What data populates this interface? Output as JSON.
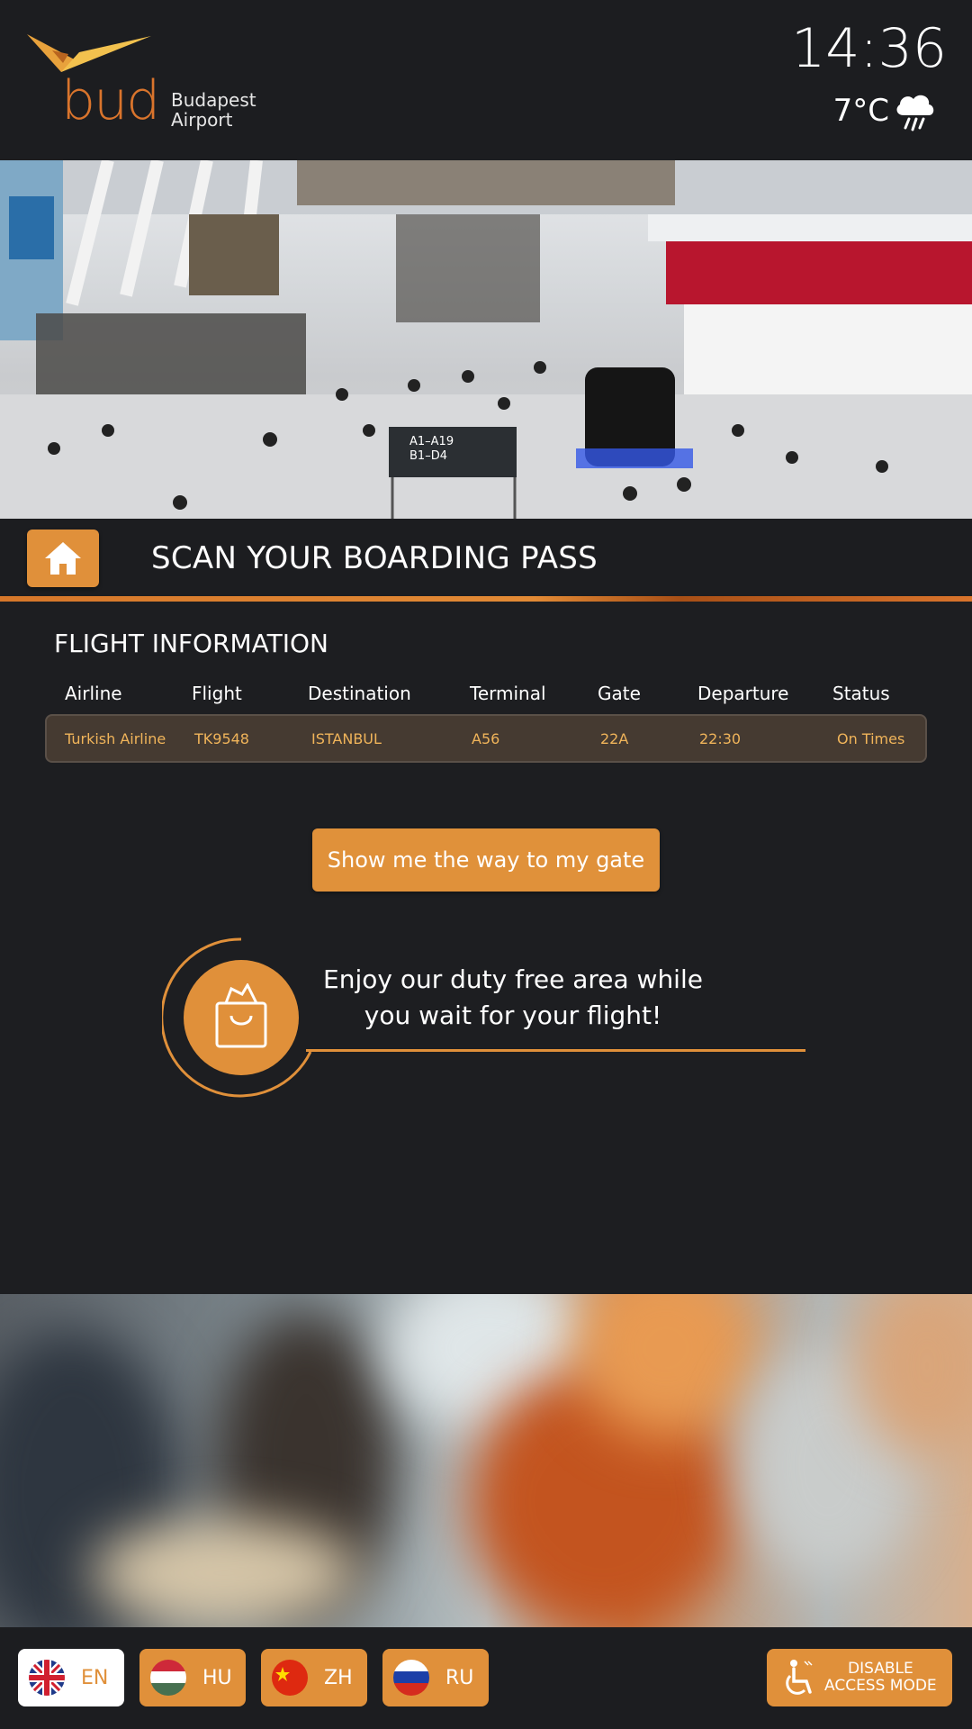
{
  "header": {
    "logo_text": "bud",
    "logo_name_line1": "Budapest",
    "logo_name_line2": "Airport",
    "time": "14:36",
    "temperature": "7°C",
    "weather_icon": "rain-cloud-icon"
  },
  "scan": {
    "title": "SCAN YOUR BOARDING PASS",
    "home_icon": "home-icon"
  },
  "flight": {
    "section_title": "FLIGHT INFORMATION",
    "columns": [
      "Airline",
      "Flight",
      "Destination",
      "Terminal",
      "Gate",
      "Departure",
      "Status"
    ],
    "row": [
      "Turkish Airline",
      "TK9548",
      "ISTANBUL",
      "A56",
      "22A",
      "22:30",
      "On Times"
    ]
  },
  "gate_button": {
    "label": "Show me the way to my gate"
  },
  "duty_free": {
    "icon": "shopping-bag-icon",
    "text": "Enjoy our duty free area while you wait for your flight!"
  },
  "footer": {
    "languages": [
      {
        "code": "EN",
        "flag": "uk-flag-icon",
        "active": true
      },
      {
        "code": "HU",
        "flag": "hungary-flag-icon",
        "active": false
      },
      {
        "code": "ZH",
        "flag": "china-flag-icon",
        "active": false
      },
      {
        "code": "RU",
        "flag": "russia-flag-icon",
        "active": false
      }
    ],
    "access_line1": "DISABLE",
    "access_line2": "ACCESS MODE",
    "access_icon": "wheelchair-icon"
  },
  "colors": {
    "accent": "#e0903a",
    "background": "#1d1e21",
    "row_text": "#f0b45a"
  }
}
